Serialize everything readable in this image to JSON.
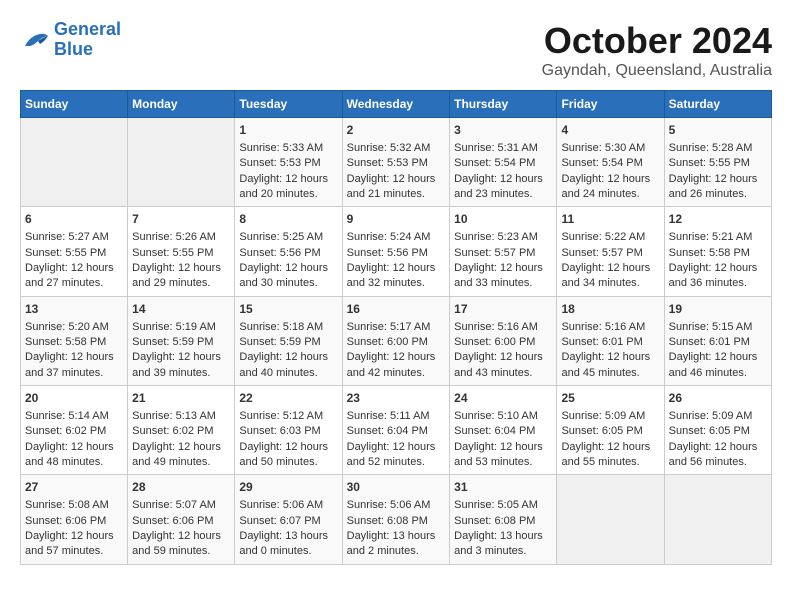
{
  "logo": {
    "line1": "General",
    "line2": "Blue"
  },
  "title": "October 2024",
  "location": "Gayndah, Queensland, Australia",
  "weekdays": [
    "Sunday",
    "Monday",
    "Tuesday",
    "Wednesday",
    "Thursday",
    "Friday",
    "Saturday"
  ],
  "weeks": [
    [
      {
        "day": "",
        "sunrise": "",
        "sunset": "",
        "daylight": "",
        "empty": true
      },
      {
        "day": "",
        "sunrise": "",
        "sunset": "",
        "daylight": "",
        "empty": true
      },
      {
        "day": "1",
        "sunrise": "Sunrise: 5:33 AM",
        "sunset": "Sunset: 5:53 PM",
        "daylight": "Daylight: 12 hours and 20 minutes."
      },
      {
        "day": "2",
        "sunrise": "Sunrise: 5:32 AM",
        "sunset": "Sunset: 5:53 PM",
        "daylight": "Daylight: 12 hours and 21 minutes."
      },
      {
        "day": "3",
        "sunrise": "Sunrise: 5:31 AM",
        "sunset": "Sunset: 5:54 PM",
        "daylight": "Daylight: 12 hours and 23 minutes."
      },
      {
        "day": "4",
        "sunrise": "Sunrise: 5:30 AM",
        "sunset": "Sunset: 5:54 PM",
        "daylight": "Daylight: 12 hours and 24 minutes."
      },
      {
        "day": "5",
        "sunrise": "Sunrise: 5:28 AM",
        "sunset": "Sunset: 5:55 PM",
        "daylight": "Daylight: 12 hours and 26 minutes."
      }
    ],
    [
      {
        "day": "6",
        "sunrise": "Sunrise: 5:27 AM",
        "sunset": "Sunset: 5:55 PM",
        "daylight": "Daylight: 12 hours and 27 minutes."
      },
      {
        "day": "7",
        "sunrise": "Sunrise: 5:26 AM",
        "sunset": "Sunset: 5:55 PM",
        "daylight": "Daylight: 12 hours and 29 minutes."
      },
      {
        "day": "8",
        "sunrise": "Sunrise: 5:25 AM",
        "sunset": "Sunset: 5:56 PM",
        "daylight": "Daylight: 12 hours and 30 minutes."
      },
      {
        "day": "9",
        "sunrise": "Sunrise: 5:24 AM",
        "sunset": "Sunset: 5:56 PM",
        "daylight": "Daylight: 12 hours and 32 minutes."
      },
      {
        "day": "10",
        "sunrise": "Sunrise: 5:23 AM",
        "sunset": "Sunset: 5:57 PM",
        "daylight": "Daylight: 12 hours and 33 minutes."
      },
      {
        "day": "11",
        "sunrise": "Sunrise: 5:22 AM",
        "sunset": "Sunset: 5:57 PM",
        "daylight": "Daylight: 12 hours and 34 minutes."
      },
      {
        "day": "12",
        "sunrise": "Sunrise: 5:21 AM",
        "sunset": "Sunset: 5:58 PM",
        "daylight": "Daylight: 12 hours and 36 minutes."
      }
    ],
    [
      {
        "day": "13",
        "sunrise": "Sunrise: 5:20 AM",
        "sunset": "Sunset: 5:58 PM",
        "daylight": "Daylight: 12 hours and 37 minutes."
      },
      {
        "day": "14",
        "sunrise": "Sunrise: 5:19 AM",
        "sunset": "Sunset: 5:59 PM",
        "daylight": "Daylight: 12 hours and 39 minutes."
      },
      {
        "day": "15",
        "sunrise": "Sunrise: 5:18 AM",
        "sunset": "Sunset: 5:59 PM",
        "daylight": "Daylight: 12 hours and 40 minutes."
      },
      {
        "day": "16",
        "sunrise": "Sunrise: 5:17 AM",
        "sunset": "Sunset: 6:00 PM",
        "daylight": "Daylight: 12 hours and 42 minutes."
      },
      {
        "day": "17",
        "sunrise": "Sunrise: 5:16 AM",
        "sunset": "Sunset: 6:00 PM",
        "daylight": "Daylight: 12 hours and 43 minutes."
      },
      {
        "day": "18",
        "sunrise": "Sunrise: 5:16 AM",
        "sunset": "Sunset: 6:01 PM",
        "daylight": "Daylight: 12 hours and 45 minutes."
      },
      {
        "day": "19",
        "sunrise": "Sunrise: 5:15 AM",
        "sunset": "Sunset: 6:01 PM",
        "daylight": "Daylight: 12 hours and 46 minutes."
      }
    ],
    [
      {
        "day": "20",
        "sunrise": "Sunrise: 5:14 AM",
        "sunset": "Sunset: 6:02 PM",
        "daylight": "Daylight: 12 hours and 48 minutes."
      },
      {
        "day": "21",
        "sunrise": "Sunrise: 5:13 AM",
        "sunset": "Sunset: 6:02 PM",
        "daylight": "Daylight: 12 hours and 49 minutes."
      },
      {
        "day": "22",
        "sunrise": "Sunrise: 5:12 AM",
        "sunset": "Sunset: 6:03 PM",
        "daylight": "Daylight: 12 hours and 50 minutes."
      },
      {
        "day": "23",
        "sunrise": "Sunrise: 5:11 AM",
        "sunset": "Sunset: 6:04 PM",
        "daylight": "Daylight: 12 hours and 52 minutes."
      },
      {
        "day": "24",
        "sunrise": "Sunrise: 5:10 AM",
        "sunset": "Sunset: 6:04 PM",
        "daylight": "Daylight: 12 hours and 53 minutes."
      },
      {
        "day": "25",
        "sunrise": "Sunrise: 5:09 AM",
        "sunset": "Sunset: 6:05 PM",
        "daylight": "Daylight: 12 hours and 55 minutes."
      },
      {
        "day": "26",
        "sunrise": "Sunrise: 5:09 AM",
        "sunset": "Sunset: 6:05 PM",
        "daylight": "Daylight: 12 hours and 56 minutes."
      }
    ],
    [
      {
        "day": "27",
        "sunrise": "Sunrise: 5:08 AM",
        "sunset": "Sunset: 6:06 PM",
        "daylight": "Daylight: 12 hours and 57 minutes."
      },
      {
        "day": "28",
        "sunrise": "Sunrise: 5:07 AM",
        "sunset": "Sunset: 6:06 PM",
        "daylight": "Daylight: 12 hours and 59 minutes."
      },
      {
        "day": "29",
        "sunrise": "Sunrise: 5:06 AM",
        "sunset": "Sunset: 6:07 PM",
        "daylight": "Daylight: 13 hours and 0 minutes."
      },
      {
        "day": "30",
        "sunrise": "Sunrise: 5:06 AM",
        "sunset": "Sunset: 6:08 PM",
        "daylight": "Daylight: 13 hours and 2 minutes."
      },
      {
        "day": "31",
        "sunrise": "Sunrise: 5:05 AM",
        "sunset": "Sunset: 6:08 PM",
        "daylight": "Daylight: 13 hours and 3 minutes."
      },
      {
        "day": "",
        "sunrise": "",
        "sunset": "",
        "daylight": "",
        "empty": true
      },
      {
        "day": "",
        "sunrise": "",
        "sunset": "",
        "daylight": "",
        "empty": true
      }
    ]
  ]
}
